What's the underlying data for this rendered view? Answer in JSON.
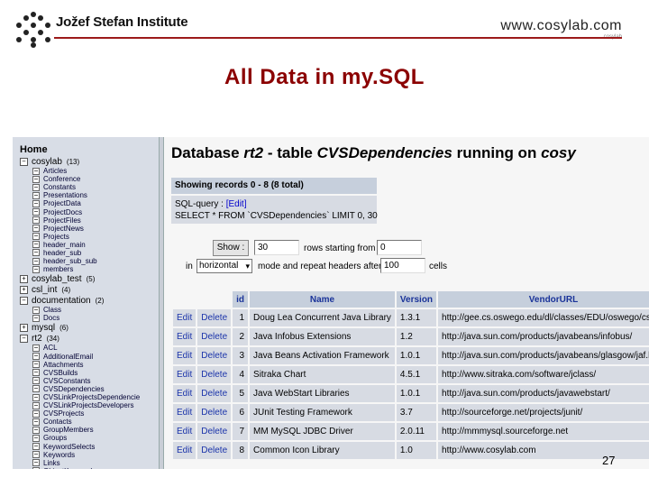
{
  "slide": {
    "institute": "Jožef Stefan Institute",
    "website": "www.cosylab.com",
    "website_small": "cosylab",
    "title": "All Data in my.SQL",
    "page_number": "27",
    "accent_color": "#8b0000"
  },
  "sidebar": {
    "home_label": "Home",
    "databases": [
      {
        "name": "cosylab",
        "count": "(13)",
        "state": "expanded",
        "tables": [
          "Articles",
          "Conference",
          "Constants",
          "Presentations",
          "ProjectData",
          "ProjectDocs",
          "ProjectFiles",
          "ProjectNews",
          "Projects",
          "header_main",
          "header_sub",
          "header_sub_sub",
          "members"
        ]
      },
      {
        "name": "cosylab_test",
        "count": "(5)",
        "state": "collapsed",
        "tables": []
      },
      {
        "name": "csl_int",
        "count": "(4)",
        "state": "collapsed",
        "tables": []
      },
      {
        "name": "documentation",
        "count": "(2)",
        "state": "expanded",
        "tables": [
          "Class",
          "Docs"
        ]
      },
      {
        "name": "mysql",
        "count": "(6)",
        "state": "collapsed",
        "tables": []
      },
      {
        "name": "rt2",
        "count": "(34)",
        "state": "expanded",
        "tables": [
          "ACL",
          "AdditionalEmail",
          "Attachments",
          "CVSBuilds",
          "CVSConstants",
          "CVSDependencies",
          "CVSLinkProjectsDependencie",
          "CVSLinkProjectsDevelopers",
          "CVSProjects",
          "Contacts",
          "GroupMembers",
          "Groups",
          "KeywordSelects",
          "Keywords",
          "Links",
          "ObjectKeywords"
        ]
      }
    ]
  },
  "main": {
    "title_prefix": "Database",
    "db_name": "rt2",
    "title_mid": "- table",
    "table_name": "CVSDependencies",
    "title_suffix": "running on",
    "host": "cosy",
    "showing_records": "Showing records 0 - 8 (8 total)",
    "sql_query_label": "SQL-query :",
    "edit_link": "[Edit]",
    "sql_query": "SELECT * FROM `CVSDependencies` LIMIT 0, 30",
    "show_button": "Show :",
    "rows_value": "30",
    "rows_text": "rows starting from",
    "start_value": "0",
    "in_text": "in",
    "mode_value": "horizontal",
    "mode_text": "mode and repeat headers after",
    "repeat_value": "100",
    "cells_text": "cells"
  },
  "table": {
    "columns": [
      "id",
      "Name",
      "Version",
      "VendorURL"
    ],
    "edit_label": "Edit",
    "delete_label": "Delete",
    "rows": [
      {
        "id": "1",
        "name": "Doug Lea Concurrent Java Library",
        "version": "1.3.1",
        "url": "http://gee.cs.oswego.edu/dl/classes/EDU/oswego/cs/dl/"
      },
      {
        "id": "2",
        "name": "Java Infobus Extensions",
        "version": "1.2",
        "url": "http://java.sun.com/products/javabeans/infobus/"
      },
      {
        "id": "3",
        "name": "Java Beans Activation Framework",
        "version": "1.0.1",
        "url": "http://java.sun.com/products/javabeans/glasgow/jaf.html"
      },
      {
        "id": "4",
        "name": "Sitraka Chart",
        "version": "4.5.1",
        "url": "http://www.sitraka.com/software/jclass/"
      },
      {
        "id": "5",
        "name": "Java WebStart Libraries",
        "version": "1.0.1",
        "url": "http://java.sun.com/products/javawebstart/"
      },
      {
        "id": "6",
        "name": "JUnit Testing Framework",
        "version": "3.7",
        "url": "http://sourceforge.net/projects/junit/"
      },
      {
        "id": "7",
        "name": "MM MySQL JDBC Driver",
        "version": "2.0.11",
        "url": "http://mmmysql.sourceforge.net"
      },
      {
        "id": "8",
        "name": "Common Icon Library",
        "version": "1.0",
        "url": "http://www.cosylab.com"
      }
    ]
  }
}
